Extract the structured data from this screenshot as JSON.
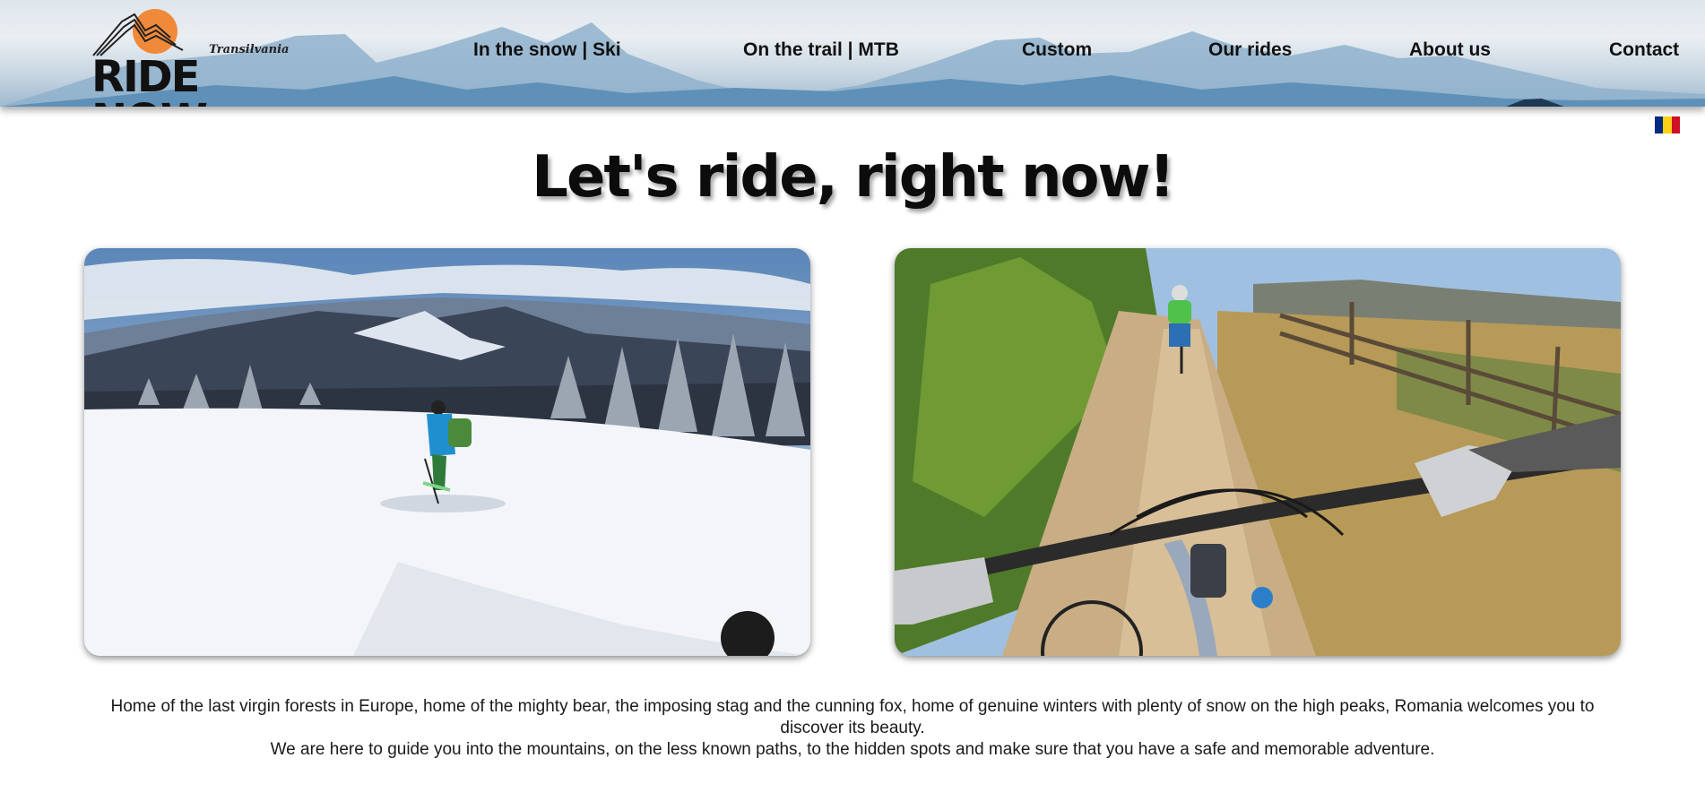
{
  "brand": {
    "tagline": "Transilvania",
    "wordmark": "RIDE NOW",
    "sun_color": "#f08a3a"
  },
  "nav": {
    "items": [
      {
        "label": "In the snow | Ski"
      },
      {
        "label": "On the trail | MTB"
      },
      {
        "label": "Custom"
      },
      {
        "label": "Our rides"
      },
      {
        "label": "About us"
      },
      {
        "label": "Contact"
      }
    ]
  },
  "language_flag": {
    "icon": "romania-flag-icon",
    "colors": [
      "#002b7f",
      "#fcd116",
      "#ce1126"
    ]
  },
  "hero": {
    "title": "Let's ride, right now!"
  },
  "photos": [
    {
      "icon": "ski-photo"
    },
    {
      "icon": "mtb-photo"
    }
  ],
  "description": {
    "line1": "Home of the last virgin forests in Europe, home of the mighty bear, the imposing stag and the cunning fox, home of genuine winters with plenty of snow on the high peaks, Romania welcomes you to discover its beauty.",
    "line2": "We are here to guide you into the mountains, on the less known paths, to the hidden spots and make sure that you have a safe and memorable adventure."
  }
}
